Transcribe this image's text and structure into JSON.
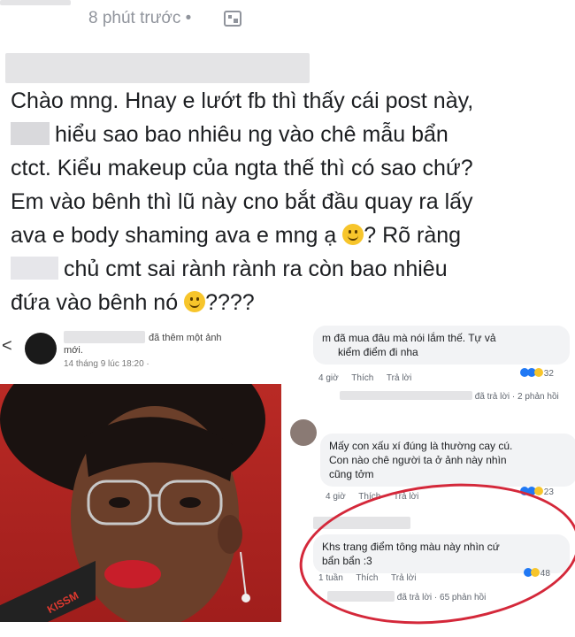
{
  "post": {
    "timestamp": "8 phút trước",
    "separator": "•",
    "privacy_icon": "image-icon",
    "lines": [
      "Chào mng. Hnay e lướt fb thì thấy cái post này,",
      "hiểu sao bao nhiêu ng vào chê mẫu bẩn",
      "ctct. Kiểu makeup của ngta thế thì có sao chứ?",
      "Em vào bênh thì lũ này cno bắt đầu quay ra lấy",
      "ava e body shaming ava e mng ạ",
      "? Rõ ràng",
      "chủ cmt sai rành rành ra còn bao nhiêu",
      "đứa vào bênh nó",
      "????"
    ]
  },
  "left_shot": {
    "back_icon": "back-arrow-icon",
    "action": "đã thêm một ảnh",
    "action2": "mới.",
    "time": "14 tháng 9 lúc 18:20 ·",
    "lipstick_brand": "KISSM"
  },
  "right_shot": {
    "c1_text_1": "m đã mua đâu mà nói lắm thế. Tự vả",
    "c1_text_2": "kiểm điểm đi nha",
    "c1_time": "4 giờ",
    "like": "Thích",
    "reply": "Trả lời",
    "c1_reacts": "32",
    "c1_replies": "đã trả lời · 2 phản hồi",
    "c2_text_1": "Mấy con xấu xí đúng là thường cay cú.",
    "c2_text_2": "Con nào chê người ta ở ảnh này nhìn",
    "c2_text_3": "cũng tởm",
    "c2_time": "4 giờ",
    "c2_reacts": "23",
    "c3_text_1": "Khs trang điểm tông màu này nhìn cứ",
    "c3_text_2": "bẩn bẩn :3",
    "c3_time": "1 tuần",
    "c3_reacts": "48",
    "c3_replies": "đã trả lời · 65 phản hồi",
    "highlight_color": "#d4283a"
  }
}
